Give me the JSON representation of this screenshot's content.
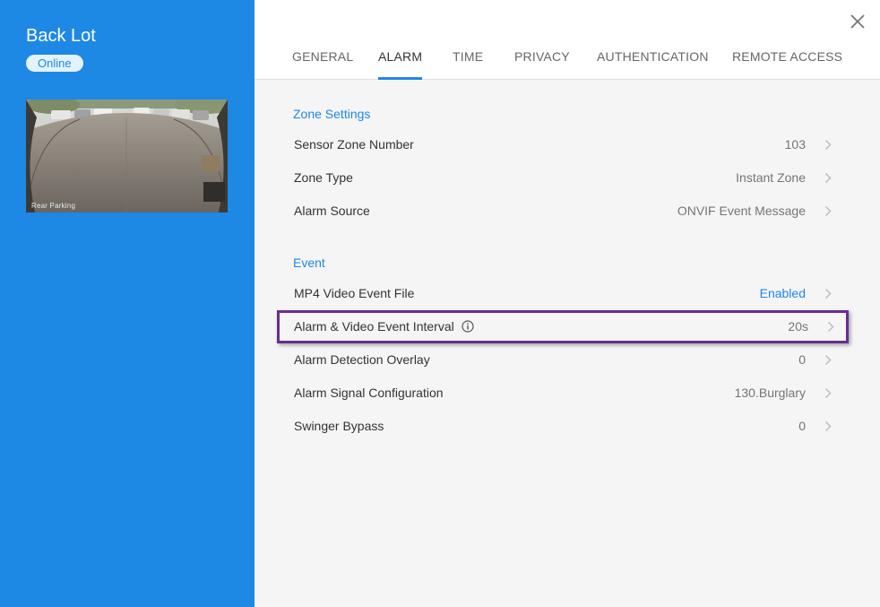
{
  "device": {
    "name": "Back Lot",
    "status": "Online",
    "camera_caption": "Rear Parking"
  },
  "tabs": [
    {
      "label": "GENERAL",
      "active": false
    },
    {
      "label": "ALARM",
      "active": true
    },
    {
      "label": "TIME",
      "active": false
    },
    {
      "label": "PRIVACY",
      "active": false
    },
    {
      "label": "AUTHENTICATION",
      "active": false
    },
    {
      "label": "REMOTE ACCESS",
      "active": false
    }
  ],
  "sections": {
    "zone": {
      "title": "Zone Settings",
      "rows": [
        {
          "label": "Sensor Zone Number",
          "value": "103"
        },
        {
          "label": "Zone Type",
          "value": "Instant Zone"
        },
        {
          "label": "Alarm Source",
          "value": "ONVIF Event Message"
        }
      ]
    },
    "event": {
      "title": "Event",
      "rows": [
        {
          "label": "MP4 Video Event File",
          "value": "Enabled"
        },
        {
          "label": "Alarm & Video Event Interval",
          "value": "20s"
        },
        {
          "label": "Alarm Detection Overlay",
          "value": "0"
        },
        {
          "label": "Alarm Signal Configuration",
          "value": "130.Burglary"
        },
        {
          "label": "Swinger Bypass",
          "value": "0"
        }
      ]
    }
  },
  "icons": {
    "close": "close-icon",
    "chevron": "chevron-right-icon",
    "info": "info-icon"
  },
  "colors": {
    "accent": "#1e88e5",
    "highlight_border": "#6a2c91",
    "sidebar_bg": "#1e88e5",
    "main_bg": "#f5f5f5"
  }
}
